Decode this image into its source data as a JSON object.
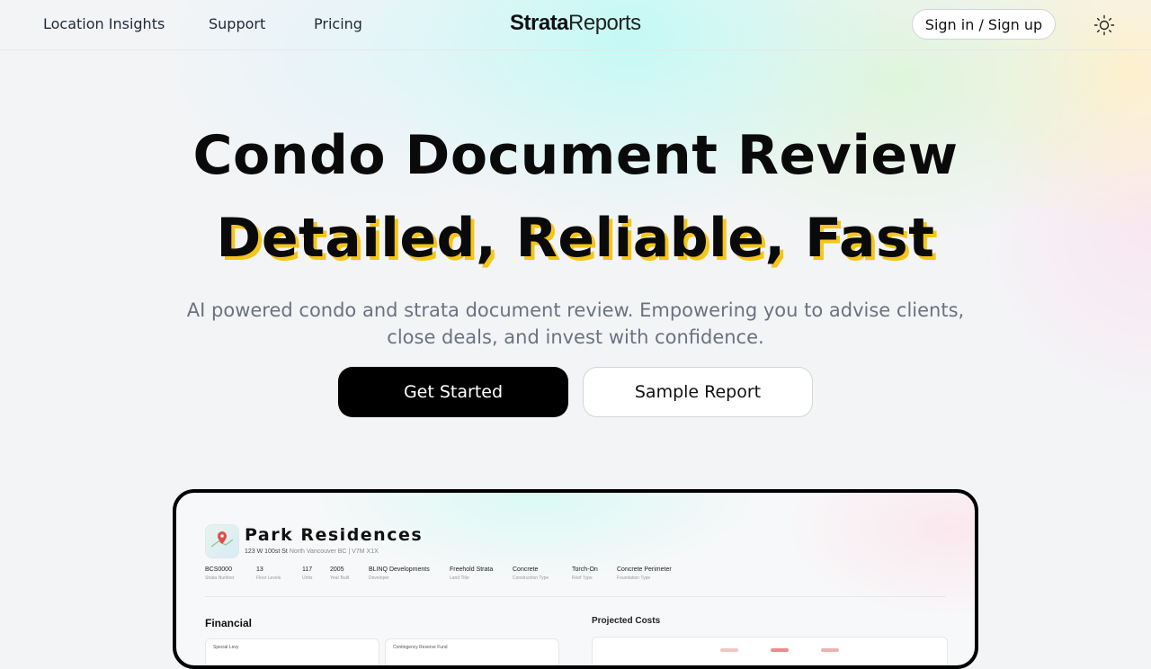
{
  "nav": {
    "links": [
      "Location Insights",
      "Support",
      "Pricing"
    ],
    "logo_bold": "Strata",
    "logo_regular": "Reports",
    "signin_label": "Sign in / Sign up",
    "theme_icon": "sun-icon"
  },
  "hero": {
    "title": "Condo Document Review",
    "tagline": "Detailed, Reliable, Fast",
    "subtitle": "AI powered condo and strata document review. Empowering you to advise clients, close deals, and invest with confidence.",
    "primary_cta": "Get Started",
    "secondary_cta": "Sample Report",
    "accent_color": "#f5c518"
  },
  "preview": {
    "building_name": "Park Residences",
    "address": "123 W 100st St",
    "city": "North Vancouver BC | V7M X1X",
    "facts": [
      {
        "value": "BCS0000",
        "label": "Strata Number"
      },
      {
        "value": "13",
        "label": "Floor Levels"
      },
      {
        "value": "117",
        "label": "Units"
      },
      {
        "value": "2005",
        "label": "Year Built"
      },
      {
        "value": "BLINQ Developments",
        "label": "Developer"
      },
      {
        "value": "Freehold Strata",
        "label": "Land Title"
      },
      {
        "value": "Concrete",
        "label": "Construction Type"
      },
      {
        "value": "Torch-On",
        "label": "Roof Type"
      },
      {
        "value": "Concrete Perimeter",
        "label": "Foundation Type"
      }
    ],
    "financial_heading": "Financial",
    "projected_heading": "Projected Costs",
    "card_titles": [
      "Special Levy",
      "Contingency Reserve Fund"
    ]
  }
}
